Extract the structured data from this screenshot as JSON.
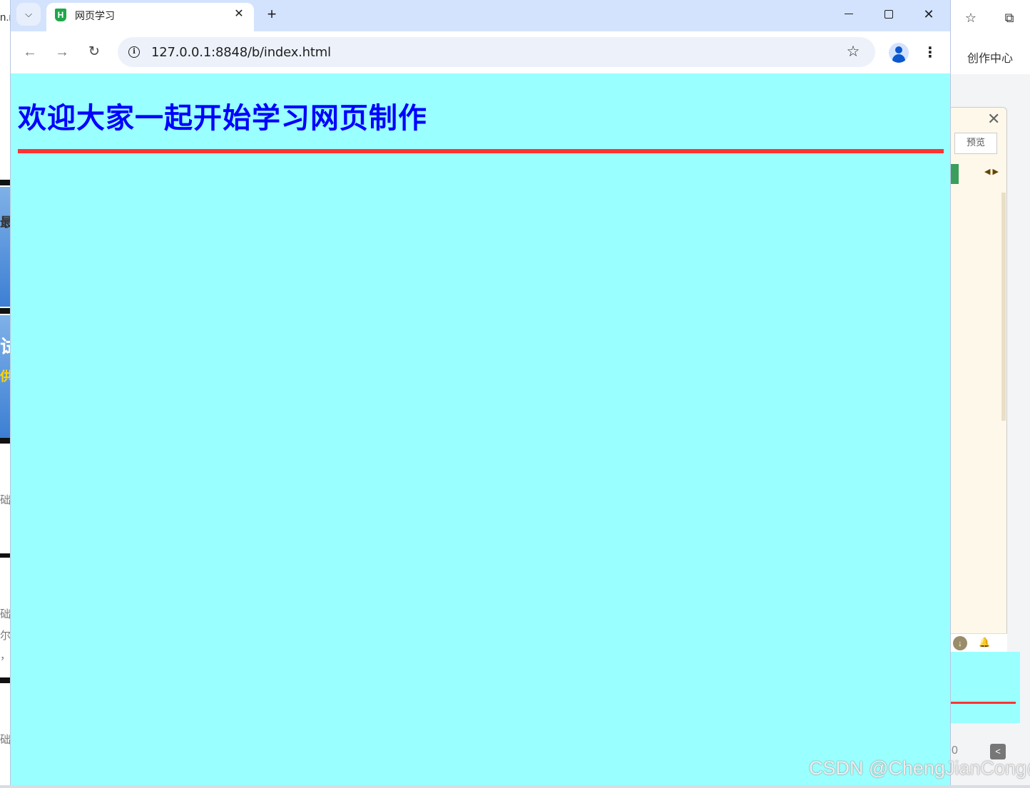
{
  "background_left": {
    "frag_top": "n.r",
    "frag_1": "最",
    "frag_2": "试",
    "frag_3": "供",
    "frag_4": "础",
    "frag_5": "础",
    "frag_6": "尔",
    "frag_7": "，",
    "frag_8": "础"
  },
  "background_right": {
    "create_center": "创作中心",
    "preview_label": "预览",
    "count": "0"
  },
  "browser": {
    "tab": {
      "title": "网页学习",
      "favicon_letter": "H"
    },
    "omnibox": {
      "url": "127.0.0.1:8848/b/index.html"
    },
    "icons": {
      "tab_list": "chevron-down",
      "tab_close": "close",
      "new_tab": "plus",
      "back": "arrow-left",
      "forward": "arrow-right",
      "reload": "reload",
      "site_info": "info",
      "bookmark": "star",
      "profile": "person",
      "menu": "kebab"
    }
  },
  "page": {
    "heading": "欢迎大家一起开始学习网页制作",
    "background_color": "#99ffff",
    "heading_color": "#0000ff",
    "rule_color": "#ff3333"
  },
  "watermark": "CSDN @ChengJianCong@"
}
